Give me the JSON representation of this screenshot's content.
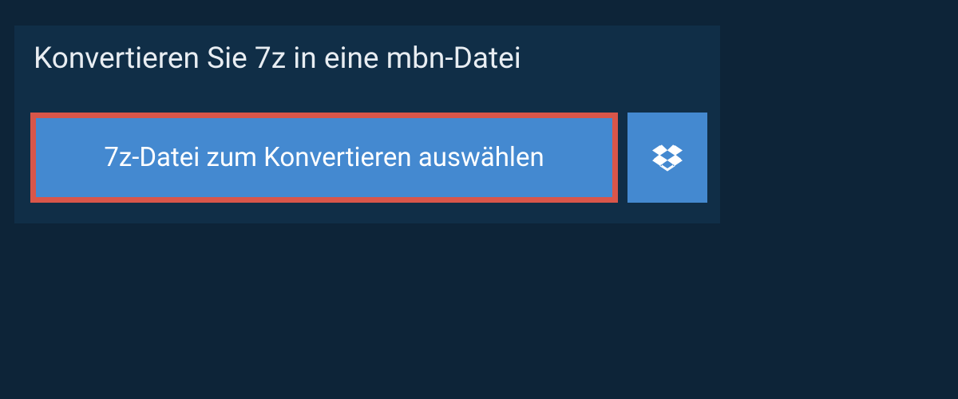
{
  "panel": {
    "title": "Konvertieren Sie 7z in eine mbn-Datei",
    "select_button_label": "7z-Datei zum Konvertieren auswählen"
  }
}
